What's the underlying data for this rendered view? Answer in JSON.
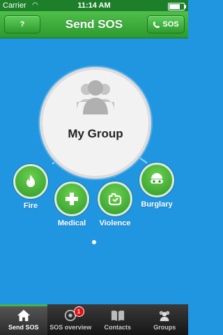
{
  "status": {
    "carrier": "Carrier",
    "time": "11:14 AM",
    "battery_level": 0.8
  },
  "nav": {
    "title": "Send SOS",
    "left_button": "?",
    "right_button": "SOS"
  },
  "group": {
    "label": "My Group",
    "icon": "group-icon"
  },
  "categories": [
    {
      "label": "Fire",
      "icon": "fire-icon"
    },
    {
      "label": "Medical",
      "icon": "medical-cross-icon"
    },
    {
      "label": "Violence",
      "icon": "fist-icon"
    },
    {
      "label": "Burglary",
      "icon": "burglar-mask-icon"
    }
  ],
  "tabs": [
    {
      "label": "Send SOS",
      "icon": "home-icon",
      "active": true
    },
    {
      "label": "SOS overview",
      "icon": "radar-icon",
      "badge": "1"
    },
    {
      "label": "Contacts",
      "icon": "book-icon"
    },
    {
      "label": "Groups",
      "icon": "groups-icon"
    }
  ],
  "colors": {
    "background": "#2196e0",
    "accent": "#3aa63a",
    "badge": "#dd1111"
  }
}
